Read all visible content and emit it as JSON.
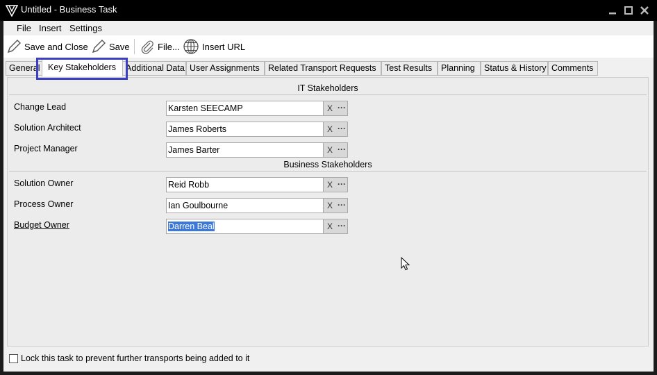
{
  "window": {
    "title": "Untitled - Business Task",
    "controls": {
      "minimize_icon": "minimize-icon",
      "maximize_icon": "maximize-icon",
      "close_icon": "close-icon"
    }
  },
  "menubar": {
    "file": "File",
    "insert": "Insert",
    "settings": "Settings"
  },
  "toolbar": {
    "save_and_close": "Save and Close",
    "save": "Save",
    "file": "File...",
    "insert_url": "Insert URL"
  },
  "tabs": [
    {
      "label": "General"
    },
    {
      "label": "Key Stakeholders",
      "active": true
    },
    {
      "label": "Additional Data"
    },
    {
      "label": "User Assignments"
    },
    {
      "label": "Related Transport Requests"
    },
    {
      "label": "Test Results"
    },
    {
      "label": "Planning"
    },
    {
      "label": "Status & History"
    },
    {
      "label": "Comments"
    }
  ],
  "sections": {
    "it": "IT Stakeholders",
    "business": "Business Stakeholders"
  },
  "fields": [
    {
      "label": "Change Lead",
      "value": "Karsten SEECAMP"
    },
    {
      "label": "Solution Architect",
      "value": "James Roberts"
    },
    {
      "label": "Project Manager",
      "value": "James Barter"
    },
    {
      "label": "Solution Owner",
      "value": "Reid Robb"
    },
    {
      "label": "Process Owner",
      "value": "Ian Goulbourne"
    },
    {
      "label": "Budget Owner",
      "value": "Darren Beal"
    }
  ],
  "field_buttons": {
    "clear": "X",
    "more": "···"
  },
  "lock_checkbox": {
    "label": "Lock this task to prevent further transports being added to it",
    "checked": false
  },
  "colors": {
    "highlight": "#3a3fc4",
    "selection": "#3c78d8",
    "titlebar": "#000000"
  }
}
